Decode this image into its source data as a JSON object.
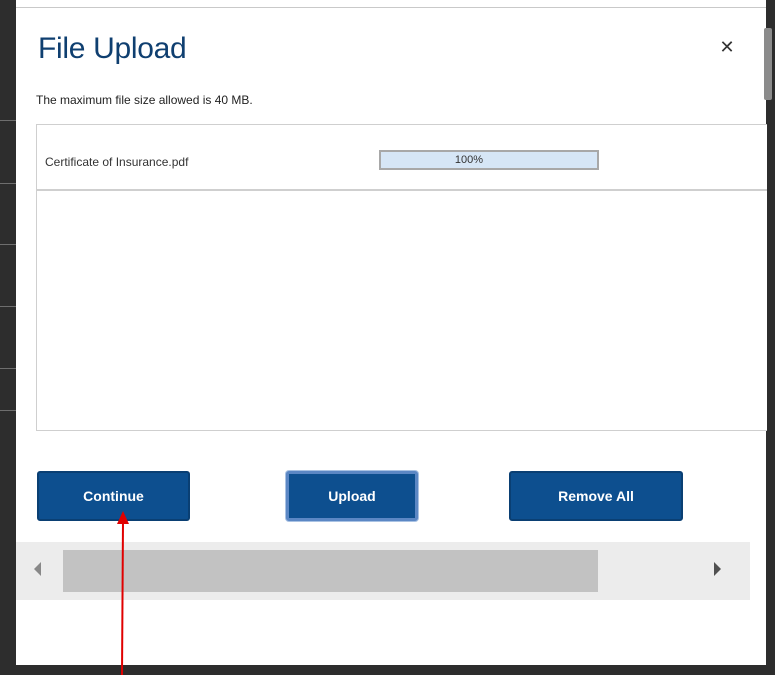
{
  "dialog": {
    "title": "File Upload",
    "close_icon": "close-icon",
    "max_size_text": "The maximum file size allowed is 40 MB."
  },
  "files": [
    {
      "name": "Certificate of Insurance.pdf",
      "progress_text": "100%",
      "progress": 1.0
    }
  ],
  "buttons": {
    "continue": "Continue",
    "upload": "Upload",
    "remove_all": "Remove All"
  },
  "scrollbar": {
    "left_icon": "scroll-left-icon",
    "right_icon": "scroll-right-icon"
  },
  "annotation": {
    "icon": "red-arrow-icon",
    "color": "#e00000"
  },
  "colors": {
    "title": "#0f3f70",
    "button": "#0d4f8f",
    "progress": "#dbe9f7"
  }
}
